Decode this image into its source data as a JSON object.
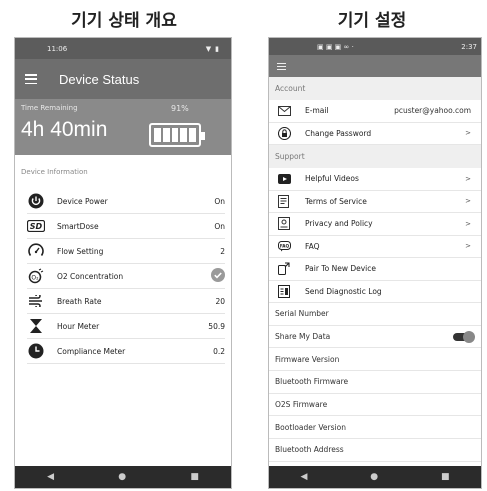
{
  "captions": {
    "left": "기기 상태 개요",
    "right": "기기 설정"
  },
  "left_phone": {
    "status_bar": {
      "time": "11:06"
    },
    "app_title": "Device Status",
    "time_remaining": {
      "label": "Time Remaining",
      "value": "4h 40min",
      "percent": "91%",
      "battery_level": 0.91
    },
    "section_title": "Device Information",
    "rows": [
      {
        "icon": "power-icon",
        "label": "Device Power",
        "value": "On"
      },
      {
        "icon": "sd-icon",
        "label": "SmartDose",
        "value": "On"
      },
      {
        "icon": "gauge-icon",
        "label": "Flow Setting",
        "value": "2"
      },
      {
        "icon": "o2-icon",
        "label": "O2 Concentration",
        "value": ""
      },
      {
        "icon": "wind-icon",
        "label": "Breath Rate",
        "value": "20"
      },
      {
        "icon": "hourglass-icon",
        "label": "Hour Meter",
        "value": "50.9"
      },
      {
        "icon": "clock-icon",
        "label": "Compliance Meter",
        "value": "0.2"
      }
    ]
  },
  "right_phone": {
    "status_bar": {
      "time": "2:37"
    },
    "account_header": "Account",
    "account_rows": [
      {
        "icon": "mail-icon",
        "label": "E-mail",
        "value": "pcuster@yahoo.com"
      },
      {
        "icon": "lock-icon",
        "label": "Change Password",
        "chevron": ">"
      }
    ],
    "support_header": "Support",
    "support_rows": [
      {
        "icon": "video-icon",
        "label": "Helpful Videos",
        "chevron": ">"
      },
      {
        "icon": "document-icon",
        "label": "Terms of Service",
        "chevron": ">"
      },
      {
        "icon": "privacy-icon",
        "label": "Privacy and Policy",
        "chevron": ">"
      },
      {
        "icon": "faq-icon",
        "label": "FAQ",
        "chevron": ">"
      },
      {
        "icon": "pair-device-icon",
        "label": "Pair To New Device",
        "chevron": ""
      },
      {
        "icon": "diagnostic-icon",
        "label": "Send Diagnostic Log",
        "chevron": ""
      }
    ],
    "plain_rows": [
      {
        "label": "Serial Number"
      },
      {
        "label": "Share My Data",
        "toggle": true
      },
      {
        "label": "Firmware Version"
      },
      {
        "label": "Bluetooth Firmware"
      },
      {
        "label": "O2S Firmware"
      },
      {
        "label": "Bootloader Version"
      },
      {
        "label": "Bluetooth Address"
      }
    ]
  },
  "nav": {
    "back": "◀",
    "home": "●",
    "recents": "■"
  }
}
